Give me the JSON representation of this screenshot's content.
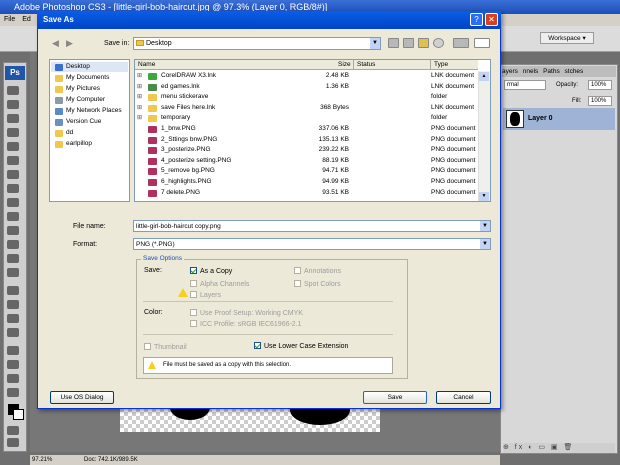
{
  "photoshop": {
    "title": "Adobe Photoshop CS3 - [little-girl-bob-haircut.jpg @ 97.3% (Layer 0, RGB/8#)]",
    "menu": [
      "File",
      "Ed"
    ],
    "workspace_label": "Workspace ▾",
    "logo": "Ps",
    "status_zoom": "97.21%",
    "status_doc": "Doc: 742.1K/989.5K",
    "layers": {
      "tabs": [
        "ayers",
        "nnels",
        "Paths",
        "stches"
      ],
      "blend_mode": "rmal",
      "opacity_label": "Opacity:",
      "opacity_value": "100%",
      "fill_label": "Fill:",
      "fill_value": "100%",
      "layer_name": "Layer 0",
      "bottom_icons": "⊕ fx ◐ ▭ ▣ 🗑"
    }
  },
  "dialog": {
    "title": "Save As",
    "help_glyph": "?",
    "close_glyph": "✕",
    "save_in_label": "Save in:",
    "save_in_value": "Desktop",
    "places": [
      {
        "label": "Desktop",
        "color": "#3b6fd0"
      },
      {
        "label": "My Documents",
        "color": "#f0c850"
      },
      {
        "label": "My Pictures",
        "color": "#f0c850"
      },
      {
        "label": "My Computer",
        "color": "#8a9aa8"
      },
      {
        "label": "My Network Places",
        "color": "#5a8ac8"
      },
      {
        "label": "Version Cue",
        "color": "#6a8fc0"
      },
      {
        "label": "dd",
        "color": "#f0c850"
      },
      {
        "label": "earlpillop",
        "color": "#f0c850"
      }
    ],
    "columns": {
      "name": "Name",
      "size": "Size",
      "status": "Status",
      "type": "Type"
    },
    "files": [
      {
        "expand": "⊞",
        "name": "CorelDRAW X3.lnk",
        "size": "2.48 KB",
        "type": "LNK document",
        "color": "#3aa83a"
      },
      {
        "expand": "⊞",
        "name": "ed games.lnk",
        "size": "1.36 KB",
        "type": "LNK document",
        "color": "#4a8a4a"
      },
      {
        "expand": "⊞",
        "name": "menu stickerave",
        "size": "",
        "type": "folder",
        "color": "#f0c850"
      },
      {
        "expand": "⊞",
        "name": "save Files here.lnk",
        "size": "368 Bytes",
        "type": "LNK document",
        "color": "#f0c850"
      },
      {
        "expand": "⊞",
        "name": "temporary",
        "size": "",
        "type": "folder",
        "color": "#f0c850"
      },
      {
        "expand": "",
        "name": "1_bnw.PNG",
        "size": "337.06 KB",
        "type": "PNG document",
        "color": "#b03060"
      },
      {
        "expand": "",
        "name": "2_Sttings bnw.PNG",
        "size": "135.13 KB",
        "type": "PNG document",
        "color": "#b03060"
      },
      {
        "expand": "",
        "name": "3_posterize.PNG",
        "size": "239.22 KB",
        "type": "PNG document",
        "color": "#b03060"
      },
      {
        "expand": "",
        "name": "4_posterize setting.PNG",
        "size": "88.19 KB",
        "type": "PNG document",
        "color": "#b03060"
      },
      {
        "expand": "",
        "name": "5_remove bg.PNG",
        "size": "94.71 KB",
        "type": "PNG document",
        "color": "#b03060"
      },
      {
        "expand": "",
        "name": "6_highlights.PNG",
        "size": "94.99 KB",
        "type": "PNG document",
        "color": "#b03060"
      },
      {
        "expand": "",
        "name": "7 delete.PNG",
        "size": "93.51 KB",
        "type": "PNG document",
        "color": "#b03060"
      }
    ],
    "file_name_label": "File name:",
    "file_name_value": "little-girl-bob-haircut copy.png",
    "format_label": "Format:",
    "format_value": "PNG (*.PNG)",
    "save_options": {
      "title": "Save Options",
      "save_label": "Save:",
      "as_a_copy": "As a Copy",
      "alpha_channels": "Alpha Channels",
      "layers": "Layers",
      "annotations": "Annotations",
      "spot_colors": "Spot Colors",
      "color_label": "Color:",
      "use_proof_setup": "Use Proof Setup:  Working CMYK",
      "icc_profile": "ICC Profile:  sRGB IEC61966-2.1",
      "thumbnail": "Thumbnail",
      "lower_case": "Use Lower Case Extension",
      "warning": "File must be saved as a copy with this selection."
    },
    "use_os_dialog": "Use OS Dialog",
    "save_button": "Save",
    "cancel_button": "Cancel"
  }
}
